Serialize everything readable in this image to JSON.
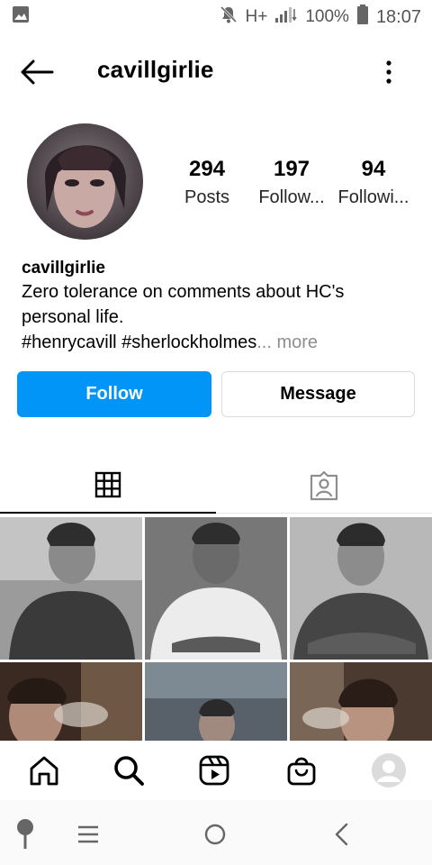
{
  "status_bar": {
    "network": "H+",
    "battery": "100%",
    "time": "18:07",
    "icons": [
      "image-icon",
      "mute-icon",
      "signal-icon",
      "battery-icon"
    ]
  },
  "header": {
    "title": "cavillgirlie",
    "back_icon": "arrow-left-icon",
    "more_icon": "vertical-dots-icon"
  },
  "profile": {
    "stats": [
      {
        "value": "294",
        "label": "Posts"
      },
      {
        "value": "197",
        "label": "Follow..."
      },
      {
        "value": "94",
        "label": "Followi..."
      }
    ],
    "name": "cavillgirlie",
    "bio_line1": "Zero tolerance on comments about HC's",
    "bio_line2": "personal life.",
    "bio_line3": "#henrycavill #sherlockholmes",
    "bio_more": "... more"
  },
  "actions": {
    "follow_label": "Follow",
    "message_label": "Message",
    "follow_color": "#0095f6"
  },
  "tabs": [
    {
      "icon": "grid-icon",
      "active": true
    },
    {
      "icon": "tagged-person-icon",
      "active": false
    }
  ],
  "bottom_nav": [
    "home-icon",
    "search-icon",
    "reels-icon",
    "shop-icon",
    "profile-avatar-icon"
  ],
  "system_nav": [
    "assistant-icon",
    "recent-apps-icon",
    "home-circle-icon",
    "back-chevron-icon"
  ]
}
